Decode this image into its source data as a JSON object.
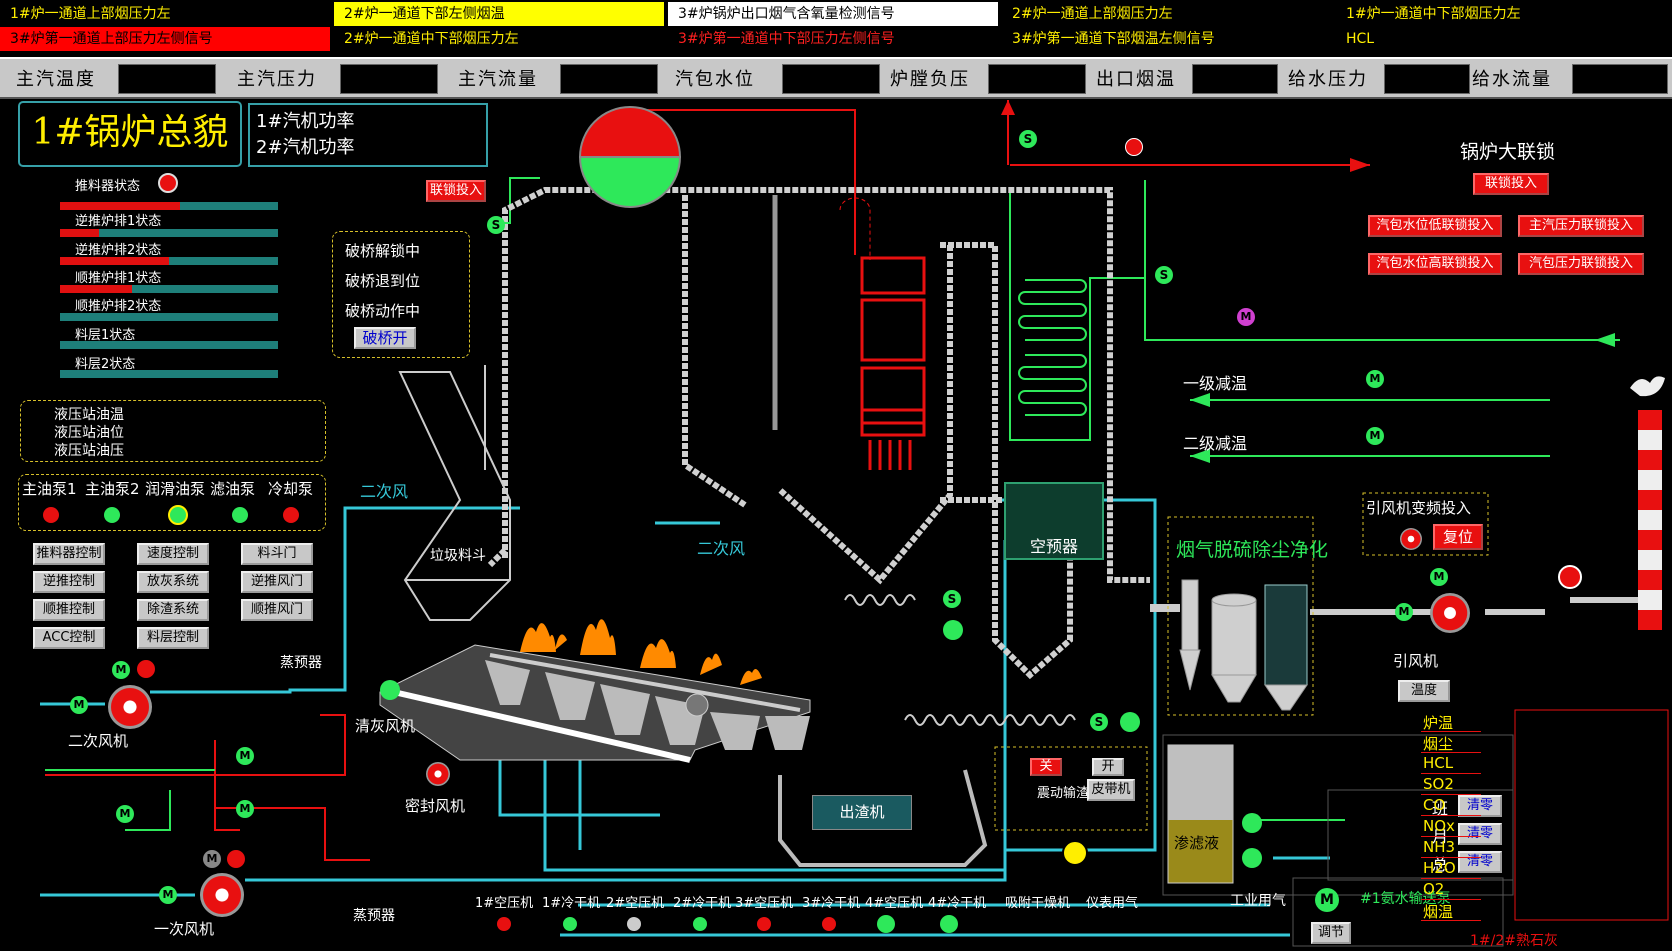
{
  "alarms": [
    {
      "text": "1#炉一通道上部烟压力左",
      "bg": "#000000",
      "fg": "#ffee00"
    },
    {
      "text": "2#炉一通道下部左侧烟温",
      "bg": "#ffff00",
      "fg": "#000000"
    },
    {
      "text": "3#炉锅炉出口烟气含氧量检测信号",
      "bg": "#ffffff",
      "fg": "#000000"
    },
    {
      "text": "2#炉一通道上部烟压力左",
      "bg": "#000000",
      "fg": "#ffee00"
    },
    {
      "text": "1#炉一通道中下部烟压力左",
      "bg": "#000000",
      "fg": "#ffee00"
    },
    {
      "text": "3#炉第一通道上部压力左侧信号",
      "bg": "#ff0000",
      "fg": "#000000"
    },
    {
      "text": "2#炉一通道中下部烟压力左",
      "bg": "#000000",
      "fg": "#ffee00"
    },
    {
      "text": "3#炉第一通道中下部压力左侧信号",
      "bg": "#000000",
      "fg": "#ff2020"
    },
    {
      "text": "3#炉第一通道下部烟温左侧信号",
      "bg": "#000000",
      "fg": "#ffee00"
    },
    {
      "text": "HCL",
      "bg": "#000000",
      "fg": "#ffee00"
    }
  ],
  "meters": [
    "主汽温度",
    "主汽压力",
    "主汽流量",
    "汽包水位",
    "炉膛负压",
    "出口烟温",
    "给水压力",
    "给水流量"
  ],
  "header": {
    "title": "1#锅炉总貌",
    "turbine1": "1#汽机功率",
    "turbine2": "2#汽机功率"
  },
  "pusher": {
    "state_label": "推料器状态",
    "rows": [
      {
        "label": "逆推炉排1状态",
        "level": 0.55
      },
      {
        "label": "逆推炉排2状态",
        "level": 0.18
      },
      {
        "label": "顺推炉排1状态",
        "level": 0.5
      },
      {
        "label": "顺推炉排2状态",
        "level": 0.33
      },
      {
        "label": "料层1状态",
        "level": 0
      },
      {
        "label": "料层2状态",
        "level": 0
      }
    ]
  },
  "interlock_btn": "联锁投入",
  "bridge": {
    "lines": [
      "破桥解锁中",
      "破桥退到位",
      "破桥动作中"
    ],
    "button": "破桥开"
  },
  "hydraulic": [
    "液压站油温",
    "液压站油位",
    "液压站油压"
  ],
  "pumps": [
    "主油泵1",
    "主油泵2",
    "润滑油泵",
    "滤油泵",
    "冷却泵"
  ],
  "controls": [
    [
      "推料器控制",
      "速度控制",
      "料斗门"
    ],
    [
      "逆推控制",
      "放灰系统",
      "逆推风门"
    ],
    [
      "顺推控制",
      "除渣系统",
      "顺推风门"
    ],
    [
      "ACC控制",
      "料层控制",
      ""
    ]
  ],
  "labels": {
    "secondary_air": "二次风",
    "secondary_air2": "二次风",
    "hopper": "垃圾料斗",
    "steam_preheater_top": "蒸预器",
    "steam_preheater_bottom": "蒸预器",
    "secondary_fan": "二次风机",
    "primary_fan": "一次风机",
    "ash_fan": "清灰风机",
    "seal_fan": "密封风机",
    "slag": "出渣机",
    "air_preheater": "空预器",
    "desulf": "烟气脱硫除尘净化",
    "id_fan": "引风机",
    "id_fan_temp": "温度",
    "id_fan_vfd": "引风机变频投入",
    "reset": "复位",
    "desup1": "一级减温",
    "desup2": "二级减温",
    "main_interlock": "锅炉大联锁",
    "leachate": "渗滤液",
    "industrial_air": "工业用气",
    "ammonia_pump": "#1氨水输送泵",
    "adjust": "调节",
    "limestone": "1#/2#熟石灰",
    "vib_conveyor": "震动输渣器",
    "belt": "皮带机",
    "close": "关",
    "open": "开"
  },
  "interlocks": [
    "联锁投入",
    "汽包水位低联锁投入",
    "主汽压力联锁投入",
    "汽包水位高联锁投入",
    "汽包压力联锁投入"
  ],
  "shift": [
    {
      "label": "班",
      "btn": "清零"
    },
    {
      "label": "月",
      "btn": "清零"
    },
    {
      "label": "总",
      "btn": "清零"
    }
  ],
  "emissions": [
    "炉温",
    "烟尘",
    "HCL",
    "SO2",
    "CO",
    "NOx",
    "NH3",
    "H2O",
    "O2",
    "烟温"
  ],
  "compressors": [
    "1#空压机",
    "1#冷干机",
    "2#空压机",
    "2#冷干机",
    "3#空压机",
    "3#冷干机",
    "4#空压机",
    "4#冷干机",
    "吸附干燥机",
    "仪表用气"
  ],
  "icon_letters": {
    "motor": "M",
    "solenoid": "S"
  }
}
